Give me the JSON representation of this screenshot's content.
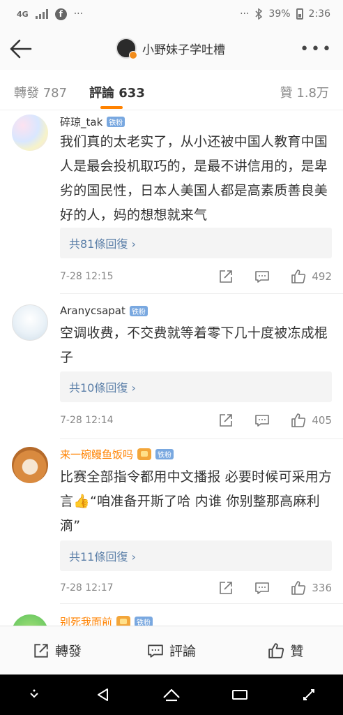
{
  "status_bar": {
    "network": "4G",
    "left_icons": [
      "signal-icon",
      "facebook-icon",
      "ellipsis-icon"
    ],
    "right_icons": [
      "ellipsis-icon",
      "bluetooth-icon",
      "battery-icon"
    ],
    "battery": "39%",
    "time": "2:36"
  },
  "header": {
    "title": "小野妹子学吐槽",
    "back_icon": "back-arrow-icon",
    "more_icon": "more-dots-icon"
  },
  "tabs": {
    "repost": "轉發 787",
    "comments": "評論 633",
    "likes": "贊 1.8万",
    "active": "comments",
    "accent": "#ff8200"
  },
  "comments": [
    {
      "username": "碎琼_tak",
      "badge": "铁粉",
      "text": "我们真的太老实了，从小还被中国人教育中国人是最会投机取巧的，是最不讲信用的，是卑劣的国民性，日本人美国人都是高素质善良美好的人，妈的想想就来气",
      "replies": "共81條回復 ›",
      "time": "7-28 12:15",
      "likes": "492"
    },
    {
      "username": "Aranycsapat",
      "badge": "铁粉",
      "text": "空调收费，不交费就等着零下几十度被冻成棍子",
      "replies": "共10條回復 ›",
      "time": "7-28 12:14",
      "likes": "405"
    },
    {
      "username": "来一碗鳗鱼饭吗",
      "badge": "铁粉",
      "text": "比赛全部指令都用中文播报 必要时候可采用方言👍“咱准备开斯了哈 内谁 你别整那高麻利滴”",
      "replies": "共11條回復 ›",
      "time": "7-28 12:17",
      "likes": "336"
    },
    {
      "username": "别死我面前",
      "badge": "铁粉"
    }
  ],
  "bottom_bar": {
    "repost": "轉發",
    "comment": "評論",
    "like": "贊"
  },
  "system_nav": [
    "down-chevron-icon",
    "back-triangle-icon",
    "home-icon",
    "recents-icon",
    "expand-icon"
  ],
  "colors": {
    "link_blue": "#5b7fa8",
    "orange_name": "#ff8200",
    "badge_blue": "#79a8e0"
  }
}
